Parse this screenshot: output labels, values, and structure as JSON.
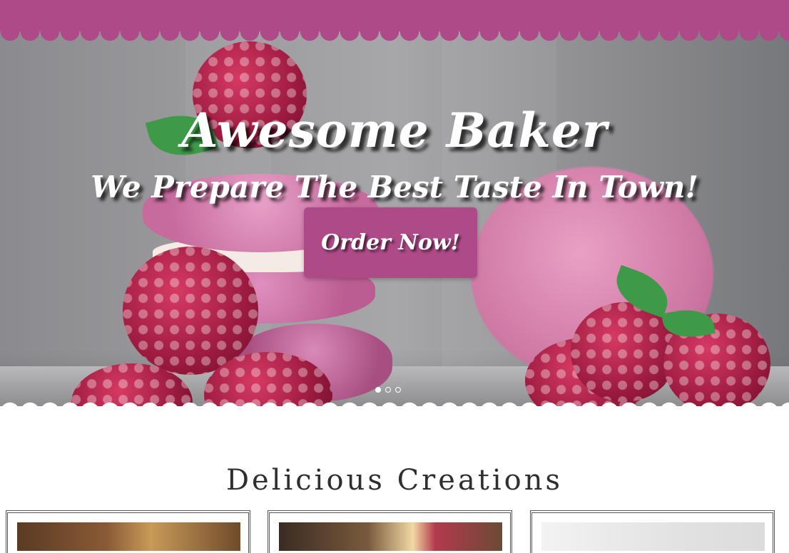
{
  "hero": {
    "title": "Awesome Baker",
    "tagline": "We Prepare The Best Taste In Town!",
    "cta_label": "Order Now!",
    "slides_count": 3,
    "active_slide": 1
  },
  "section": {
    "title": "Delicious Creations"
  },
  "colors": {
    "brand": "#ae4a87",
    "heading": "#2f2f2f"
  }
}
